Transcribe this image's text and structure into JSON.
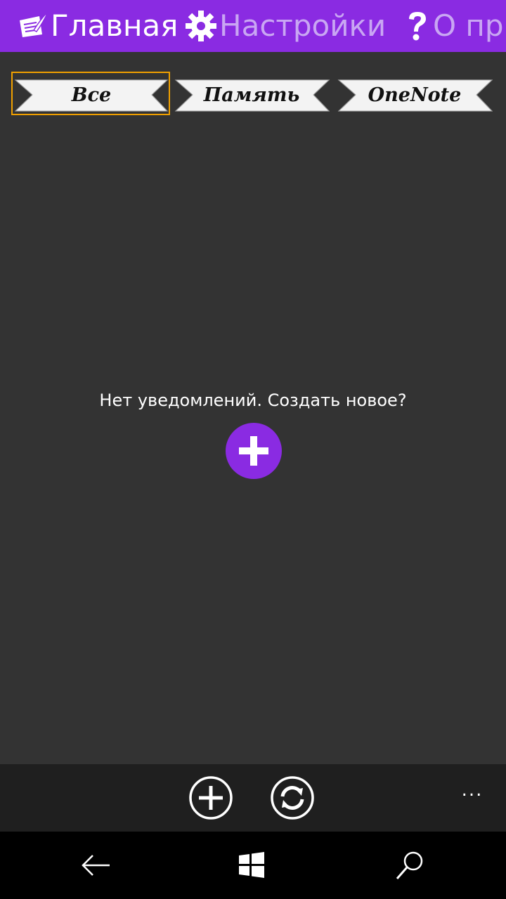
{
  "pivot": {
    "items": [
      {
        "label": "Главная",
        "icon": "quill-note-icon",
        "active": true
      },
      {
        "label": "Настройки",
        "icon": "gear-icon",
        "active": false
      },
      {
        "label": "О при",
        "icon": "question-icon",
        "active": false
      }
    ]
  },
  "filters": {
    "items": [
      {
        "label": "Все",
        "selected": true
      },
      {
        "label": "Память",
        "selected": false
      },
      {
        "label": "OneNote",
        "selected": false
      }
    ]
  },
  "empty_state": {
    "message": "Нет уведомлений. Создать новое?",
    "add_icon": "plus-icon"
  },
  "app_bar": {
    "buttons": [
      {
        "icon": "add-circle-icon"
      },
      {
        "icon": "sync-circle-icon"
      }
    ],
    "more": "..."
  },
  "nav_bar": {
    "icons": [
      "back-arrow-icon",
      "windows-logo-icon",
      "search-icon"
    ]
  },
  "colors": {
    "accent": "#8A2BE2",
    "background": "#333333",
    "selection": "#F0A000"
  }
}
